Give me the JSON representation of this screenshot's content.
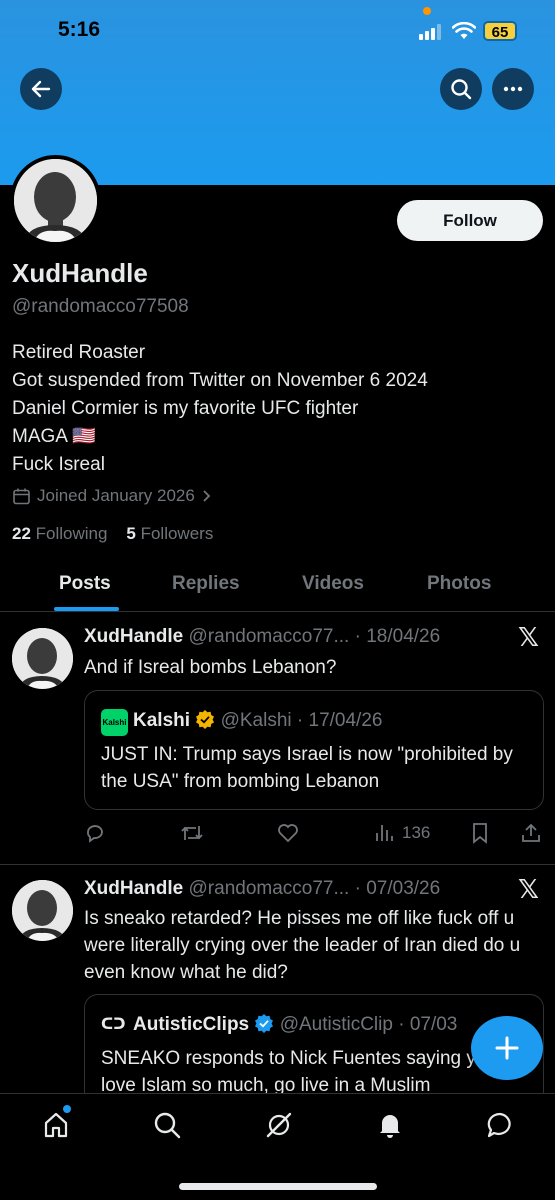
{
  "status_bar": {
    "time": "5:16",
    "battery": "65"
  },
  "profile": {
    "name": "XudHandle",
    "handle": "@randomacco77508",
    "follow_label": "Follow",
    "bio": [
      "Retired Roaster",
      "Got suspended from Twitter on November 6 2024",
      "Daniel Cormier is my favorite UFC fighter",
      "MAGA 🇺🇸",
      "Fuck Isreal"
    ],
    "joined": "Joined January 2026",
    "following_count": "22",
    "following_label": "Following",
    "followers_count": "5",
    "followers_label": "Followers"
  },
  "tabs": [
    {
      "label": "Posts",
      "active": true
    },
    {
      "label": "Replies",
      "active": false
    },
    {
      "label": "Videos",
      "active": false
    },
    {
      "label": "Photos",
      "active": false
    }
  ],
  "posts": [
    {
      "author": "XudHandle",
      "meta": "@randomacco77... · 18/04/26",
      "text": "And if Isreal bombs Lebanon?",
      "quote": {
        "badge": "Kalshi",
        "author": "Kalshi",
        "meta": "@Kalshi · 17/04/26",
        "text": "JUST IN: Trump says Israel is now \"prohibited by the USA\" from bombing Lebanon"
      },
      "views": "136"
    },
    {
      "author": "XudHandle",
      "meta": "@randomacco77... · 07/03/26",
      "text": "Is sneako retarded? He pisses me off like fuck off u were literally crying over the leader of Iran died do u even know what he did?",
      "quote": {
        "badge": "ᑕᑐ",
        "author": "AutisticClips",
        "meta": "@AutisticClip · 07/03",
        "text": "SNEAKO responds to Nick Fuentes saying you love Islam so much, go live in a Muslim"
      }
    }
  ],
  "colors": {
    "accent": "#1d9bf0",
    "banner": "#1c9bef",
    "gold_badge": "#f4b400",
    "kalshi_green": "#00d26a"
  }
}
